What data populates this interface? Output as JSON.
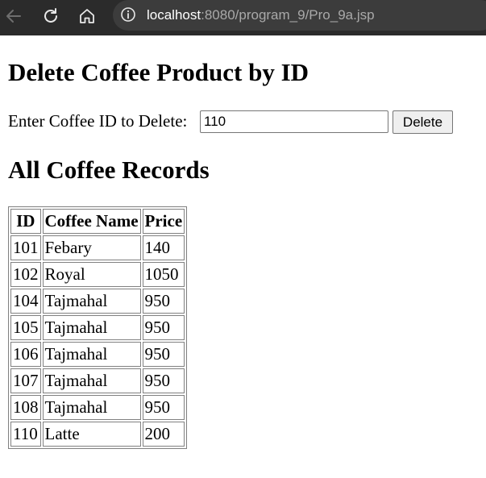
{
  "browser": {
    "url_host": "localhost",
    "url_path": ":8080/program_9/Pro_9a.jsp",
    "back_icon": "arrow-left-icon",
    "reload_icon": "reload-icon",
    "home_icon": "home-icon",
    "site_info_icon": "info-circle-icon"
  },
  "page": {
    "delete_heading": "Delete Coffee Product by ID",
    "form": {
      "label": "Enter Coffee ID to Delete:",
      "input_value": "110",
      "button_label": "Delete"
    },
    "records_heading": "All Coffee Records"
  },
  "table": {
    "headers": [
      "ID",
      "Coffee Name",
      "Price"
    ],
    "rows": [
      [
        "101",
        "Febary",
        "140"
      ],
      [
        "102",
        "Royal",
        "1050"
      ],
      [
        "104",
        "Tajmahal",
        "950"
      ],
      [
        "105",
        "Tajmahal",
        "950"
      ],
      [
        "106",
        "Tajmahal",
        "950"
      ],
      [
        "107",
        "Tajmahal",
        "950"
      ],
      [
        "108",
        "Tajmahal",
        "950"
      ],
      [
        "110",
        "Latte",
        "200"
      ]
    ]
  },
  "colors": {
    "chrome_bg": "#2b2b2b",
    "address_bg": "#3c3c3c",
    "url_muted": "#a9a9a9",
    "url_host": "#ffffff"
  }
}
